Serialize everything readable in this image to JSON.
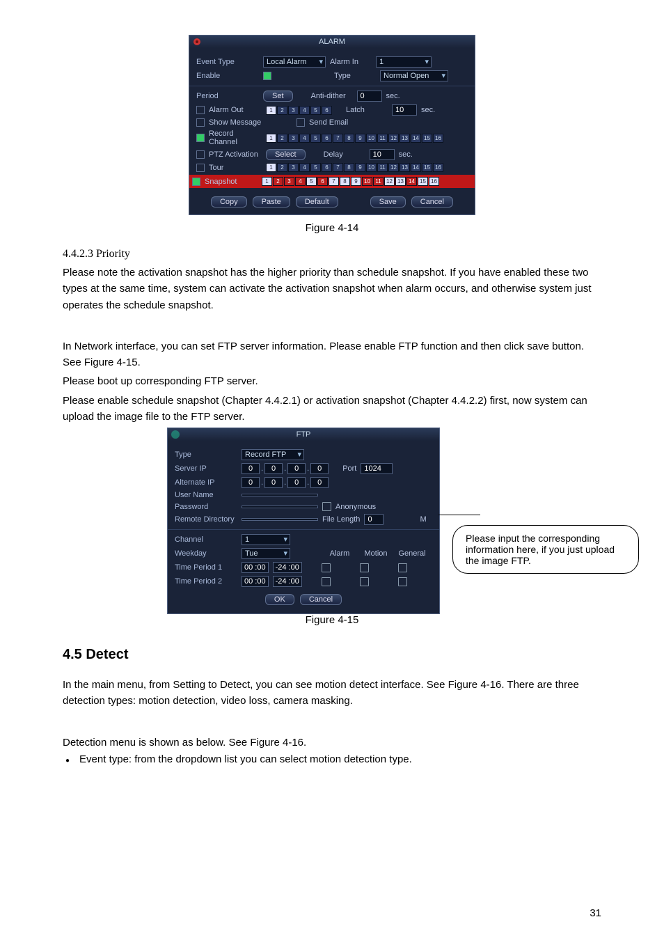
{
  "alarm": {
    "title": "ALARM",
    "eventTypeLabel": "Event Type",
    "eventTypeValue": "Local Alarm",
    "alarmInLabel": "Alarm In",
    "alarmInValue": "1",
    "enableLabel": "Enable",
    "typeLabel": "Type",
    "typeValue": "Normal Open",
    "periodLabel": "Period",
    "setBtn": "Set",
    "antiDitherLabel": "Anti-dither",
    "antiDitherValue": "0",
    "sec": "sec.",
    "alarmOutLabel": "Alarm Out",
    "latchLabel": "Latch",
    "latchValue": "10",
    "showMsgLabel": "Show Message",
    "sendEmailLabel": "Send Email",
    "recordChLabel": "Record Channel",
    "ptzLabel": "PTZ Activation",
    "selectBtn": "Select",
    "delayLabel": "Delay",
    "delayValue": "10",
    "tourLabel": "Tour",
    "snapshotLabel": "Snapshot",
    "copy": "Copy",
    "paste": "Paste",
    "default": "Default",
    "save": "Save",
    "cancel": "Cancel"
  },
  "fig414": "Figure 4-14",
  "sec4423": "4.4.2.3 Priority",
  "p1": "Please note the activation snapshot has the higher priority than schedule snapshot. If you have enabled these two types at the same time, system can activate the activation snapshot when alarm occurs, and otherwise system just operates the schedule snapshot.",
  "p2": "In Network interface, you can set FTP server information. Please enable FTP function and then click save button. See Figure 4-15.",
  "p3": "Please boot up corresponding FTP server.",
  "p4": "Please enable schedule snapshot (Chapter 4.4.2.1) or activation snapshot (Chapter 4.4.2.2) first, now system can upload the image file to the FTP server.",
  "ftp": {
    "title": "FTP",
    "typeLabel": "Type",
    "typeValue": "Record FTP",
    "serverIPLabel": "Server IP",
    "altIPLabel": "Alternate IP",
    "ip": [
      "0",
      "0",
      "0",
      "0"
    ],
    "portLabel": "Port",
    "portValue": "1024",
    "userLabel": "User Name",
    "pwdLabel": "Password",
    "anonLabel": "Anonymous",
    "remoteDirLabel": "Remote Directory",
    "fileLenLabel": "File Length",
    "fileLenValue": "0",
    "M": "M",
    "channelLabel": "Channel",
    "channelValue": "1",
    "weekdayLabel": "Weekday",
    "weekdayValue": "Tue",
    "col_alarm": "Alarm",
    "col_motion": "Motion",
    "col_general": "General",
    "tp1": "Time Period 1",
    "tp2": "Time Period 2",
    "t_start": "00 :00",
    "t_end": "-24 :00",
    "ok": "OK",
    "cancel": "Cancel"
  },
  "callout": "Please input the corresponding information here, if you just upload the image FTP.",
  "fig415": "Figure 4-15",
  "h45": "4.5  Detect",
  "p5": "In the main menu, from Setting to Detect, you can see motion detect interface. See Figure 4-16. There are three detection types: motion detection, video loss, camera masking.",
  "p6": "Detection menu is shown as below. See Figure 4-16.",
  "b1": "Event type: from the dropdown list you can select motion detection type.",
  "pagenum": "31"
}
